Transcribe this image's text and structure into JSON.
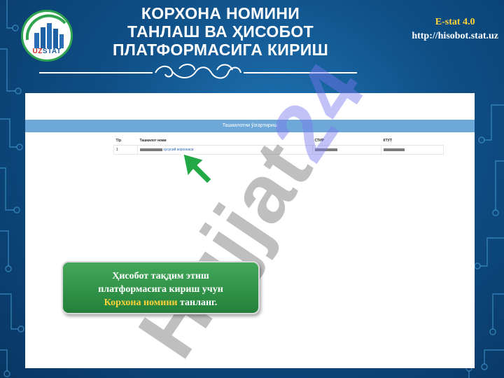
{
  "title": {
    "line1": "КОРХОНА НОМИНИ",
    "line2": "ТАНЛАШ ВА ҲИСОБОТ",
    "line3": "ПЛАТФОРМАСИГА КИРИШ"
  },
  "logo": {
    "prefix": "UZ",
    "suffix": "STAT"
  },
  "estat": {
    "name": "E-stat 4.0",
    "url": "http://hisobot.stat.uz"
  },
  "screenshot": {
    "header": "Ташкилотни ўзгартириш",
    "columns": [
      "Т/р",
      "Ташкилот номи",
      "СТИР",
      "КТУТ"
    ],
    "rows": [
      {
        "index": "1",
        "name_suffix": "хусусий корхонаси"
      }
    ]
  },
  "callout": {
    "line1": "Ҳисобот тақдим этиш",
    "line2": "платформасига кириш учун",
    "highlight": "Корхона номини",
    "tail": " танланг."
  },
  "watermark": {
    "word": "Hujjat",
    "number": "24"
  },
  "colors": {
    "background": "#0f4f86",
    "accent_yellow": "#ffd23a",
    "callout_green": "#2e9447",
    "header_blue": "#6ea8d8"
  }
}
